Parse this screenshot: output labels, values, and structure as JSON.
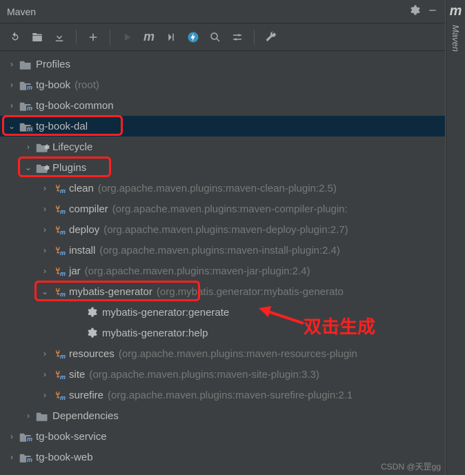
{
  "window": {
    "title": "Maven"
  },
  "side_tab": {
    "letter": "m",
    "label": "Maven"
  },
  "tree": {
    "profiles": "Profiles",
    "tg_book": {
      "label": "tg-book",
      "hint": "(root)"
    },
    "tg_book_common": "tg-book-common",
    "tg_book_dal": "tg-book-dal",
    "lifecycle": "Lifecycle",
    "plugins": "Plugins",
    "plugins_list": [
      {
        "label": "clean",
        "hint": "(org.apache.maven.plugins:maven-clean-plugin:2.5)"
      },
      {
        "label": "compiler",
        "hint": "(org.apache.maven.plugins:maven-compiler-plugin:"
      },
      {
        "label": "deploy",
        "hint": "(org.apache.maven.plugins:maven-deploy-plugin:2.7)"
      },
      {
        "label": "install",
        "hint": "(org.apache.maven.plugins:maven-install-plugin:2.4)"
      },
      {
        "label": "jar",
        "hint": "(org.apache.maven.plugins:maven-jar-plugin:2.4)"
      },
      {
        "label": "mybatis-generator",
        "hint": "(org.mybatis.generator:mybatis-generato"
      },
      {
        "label": "resources",
        "hint": "(org.apache.maven.plugins:maven-resources-plugin"
      },
      {
        "label": "site",
        "hint": "(org.apache.maven.plugins:maven-site-plugin:3.3)"
      },
      {
        "label": "surefire",
        "hint": "(org.apache.maven.plugins:maven-surefire-plugin:2.1"
      }
    ],
    "goals": {
      "generate": "mybatis-generator:generate",
      "help": "mybatis-generator:help"
    },
    "dependencies": "Dependencies",
    "tg_book_service": "tg-book-service",
    "tg_book_web": "tg-book-web"
  },
  "annotation": {
    "text": "双击生成"
  },
  "watermark": "CSDN @天罡gg"
}
